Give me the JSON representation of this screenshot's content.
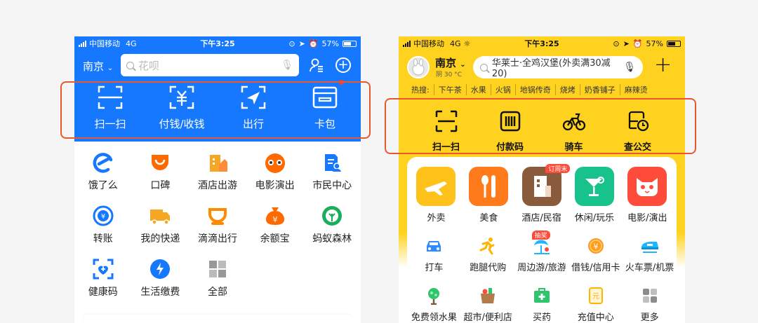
{
  "left": {
    "status": {
      "carrier": "中国移动",
      "network": "4G",
      "time": "下午3:25",
      "battery": "57%"
    },
    "city": "南京",
    "search_placeholder": "花呗",
    "quick": [
      {
        "label": "扫一扫",
        "icon": "scan-icon"
      },
      {
        "label": "付钱/收钱",
        "icon": "pay-receive-icon"
      },
      {
        "label": "出行",
        "icon": "travel-icon"
      },
      {
        "label": "卡包",
        "icon": "card-wallet-icon"
      }
    ],
    "grid": [
      {
        "label": "饿了么",
        "icon": "eleme-icon",
        "color": "#1677ff"
      },
      {
        "label": "口碑",
        "icon": "koubei-icon",
        "color": "#ff6a00"
      },
      {
        "label": "酒店出游",
        "icon": "hotel-travel-icon",
        "color": "#f5a623"
      },
      {
        "label": "电影演出",
        "icon": "movie-icon",
        "color": "#ff6a00"
      },
      {
        "label": "市民中心",
        "icon": "citizen-center-icon",
        "color": "#1677ff"
      },
      {
        "label": "转账",
        "icon": "transfer-icon",
        "color": "#1677ff"
      },
      {
        "label": "我的快递",
        "icon": "express-icon",
        "color": "#f5a623"
      },
      {
        "label": "滴滴出行",
        "icon": "didi-icon",
        "color": "#ff8a00"
      },
      {
        "label": "余额宝",
        "icon": "yuebao-icon",
        "color": "#ff6a00"
      },
      {
        "label": "蚂蚁森林",
        "icon": "ant-forest-icon",
        "color": "#1aad5c"
      },
      {
        "label": "健康码",
        "icon": "health-code-icon",
        "color": "#1677ff"
      },
      {
        "label": "生活缴费",
        "icon": "utility-bill-icon",
        "color": "#1677ff"
      },
      {
        "label": "全部",
        "icon": "all-apps-icon",
        "color": "#999999"
      }
    ]
  },
  "right": {
    "status": {
      "carrier": "中国移动",
      "network": "4G",
      "time": "下午3:25",
      "battery": "57%"
    },
    "city": "南京",
    "weather": "阴 30 °C",
    "search_text": "华莱士·全鸡汉堡(外卖满30减20)",
    "hot_label": "热搜:",
    "hot": [
      "下午茶",
      "水果",
      "火锅",
      "地锅传奇",
      "烧烤",
      "奶香铺子",
      "麻辣烫"
    ],
    "quick": [
      {
        "label": "扫一扫",
        "icon": "scan-icon"
      },
      {
        "label": "付款码",
        "icon": "pay-code-icon"
      },
      {
        "label": "骑车",
        "icon": "bike-icon"
      },
      {
        "label": "查公交",
        "icon": "bus-icon"
      }
    ],
    "big": [
      {
        "label": "外卖",
        "icon": "takeout-icon",
        "color": "#ffc21a"
      },
      {
        "label": "美食",
        "icon": "food-icon",
        "color": "#ff7a1a"
      },
      {
        "label": "酒店/民宿",
        "icon": "hotel-icon",
        "color": "#8a5a3c",
        "tag": "订周末"
      },
      {
        "label": "休闲/玩乐",
        "icon": "leisure-icon",
        "color": "#17c38a"
      },
      {
        "label": "电影/演出",
        "icon": "movie-cat-icon",
        "color": "#ff4b3a"
      }
    ],
    "small": [
      {
        "label": "打车",
        "icon": "taxi-icon",
        "color": "#2f8cff"
      },
      {
        "label": "跑腿代购",
        "icon": "errand-icon",
        "color": "#ffb400"
      },
      {
        "label": "周边游/旅游",
        "icon": "nearby-travel-icon",
        "color": "#1fb5ff",
        "tag": "抽奖"
      },
      {
        "label": "借钱/信用卡",
        "icon": "loan-icon",
        "color": "#ff9c1a"
      },
      {
        "label": "火车票/机票",
        "icon": "train-icon",
        "color": "#1fb5ff"
      },
      {
        "label": "免费领水果",
        "icon": "fruit-icon",
        "color": "#2fc56d"
      },
      {
        "label": "超市/便利店",
        "icon": "supermarket-icon",
        "color": "#2fc56d"
      },
      {
        "label": "买药",
        "icon": "medicine-icon",
        "color": "#2fc56d"
      },
      {
        "label": "充值中心",
        "icon": "recharge-icon",
        "color": "#ffb400"
      },
      {
        "label": "更多",
        "icon": "more-icon",
        "color": "#8c8c8c"
      }
    ]
  }
}
